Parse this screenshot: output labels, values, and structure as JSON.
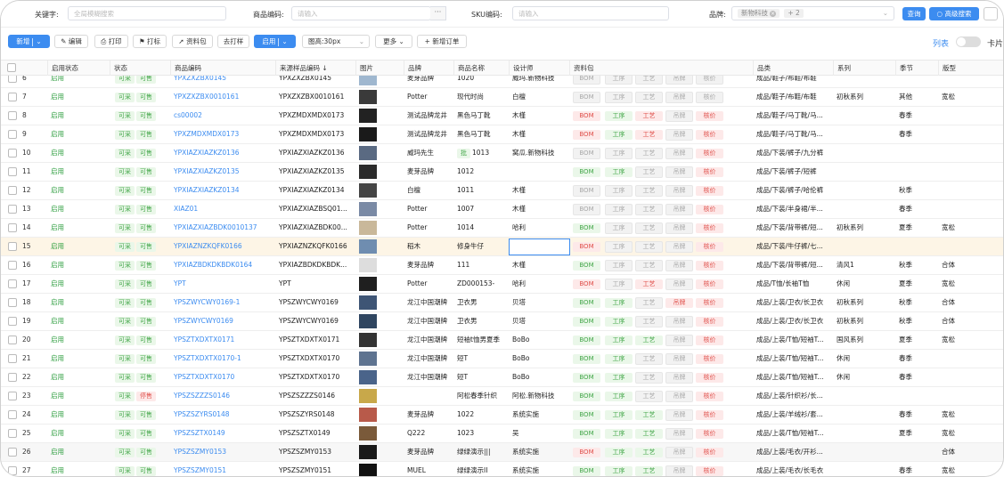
{
  "search": {
    "keyword_label": "关键字:",
    "keyword_placeholder": "全局模糊搜索",
    "code_label": "商品编码:",
    "code_placeholder": "请输入",
    "code_more": "···",
    "sku_label": "SKU编码:",
    "sku_placeholder": "请输入",
    "brand_label": "品牌:",
    "brand_tags": [
      "新物科技",
      "+ 2"
    ],
    "query_label": "查询",
    "advanced_label": "高级搜索"
  },
  "toolbar": {
    "add": "新增",
    "edit": "编辑",
    "print": "打印",
    "mark": "打标",
    "package": "资料包",
    "sample": "去打样",
    "enable": "启用",
    "img_height": "图高:30px",
    "more": "更多",
    "new_order": "新增订单",
    "view_list": "列表",
    "view_card": "卡片"
  },
  "columns": [
    "启用状态",
    "状态",
    "商品编码",
    "来源样品编码 ↓",
    "图片",
    "品牌",
    "商品名称",
    "设计师",
    "资料包",
    "品类",
    "系列",
    "季节",
    "版型"
  ],
  "pkg_labels": [
    "BOM",
    "工序",
    "工艺",
    "吊牌",
    "核价"
  ],
  "colors": {
    "accent": "#3c8cf0",
    "green": "#2e9e3f",
    "red": "#e0524d",
    "selected_row": "#fdf5e6"
  },
  "rows": [
    {
      "no": "6",
      "enabled": "启用",
      "s1": "可采",
      "s2": "可售",
      "code": "YPXZXZBX0145",
      "src": "YPXZXZBX0145",
      "brand": "麦芽品牌",
      "name": "1020",
      "designer": "威玛.新物科技",
      "pkg": [
        "gray",
        "gray",
        "gray",
        "gray",
        "gray"
      ],
      "cat": "成品/鞋子/布鞋/布鞋",
      "series": "",
      "season": "",
      "fit": ""
    },
    {
      "no": "7",
      "enabled": "启用",
      "s1": "可采",
      "s2": "可售",
      "code": "YPXZXZBX0010161",
      "src": "YPXZXZBX0010161",
      "brand": "Potter",
      "name": "现代时尚",
      "designer": "白檀",
      "pkg": [
        "gray",
        "gray",
        "gray",
        "gray",
        "gray"
      ],
      "cat": "成品/鞋子/布鞋/布鞋",
      "series": "初秋系列",
      "season": "其他",
      "fit": "宽松"
    },
    {
      "no": "8",
      "enabled": "启用",
      "s1": "可采",
      "s2": "可售",
      "code": "cs00002",
      "src": "YPXZMDXMDX0173",
      "brand": "测试品牌龙井",
      "name": "黑色马丁靴",
      "designer": "木槿",
      "pkg": [
        "r",
        "g",
        "r",
        "gray",
        "r"
      ],
      "cat": "成品/鞋子/马丁靴/马...",
      "series": "",
      "season": "春季",
      "fit": ""
    },
    {
      "no": "9",
      "enabled": "启用",
      "s1": "可采",
      "s2": "可售",
      "code": "YPXZMDXMDX0173",
      "src": "YPXZMDXMDX0173",
      "brand": "测试品牌龙井",
      "name": "黑色马丁靴",
      "designer": "木槿",
      "pkg": [
        "r",
        "g",
        "r",
        "gray",
        "r"
      ],
      "cat": "成品/鞋子/马丁靴/马...",
      "series": "",
      "season": "春季",
      "fit": ""
    },
    {
      "no": "10",
      "enabled": "启用",
      "s1": "可采",
      "s2": "可售",
      "code": "YPXIAZXIAZKZ0136",
      "src": "YPXIAZXIAZKZ0136",
      "brand": "威玛先生",
      "name": "1013",
      "name_badge": "批",
      "designer": "窝瓜.新物科技",
      "pkg": [
        "gray",
        "gray",
        "gray",
        "gray",
        "r"
      ],
      "cat": "成品/下装/裤子/九分裤",
      "series": "",
      "season": "",
      "fit": ""
    },
    {
      "no": "11",
      "enabled": "启用",
      "s1": "可采",
      "s2": "可售",
      "code": "YPXIAZXIAZKZ0135",
      "src": "YPXIAZXIAZKZ0135",
      "brand": "麦芽品牌",
      "name": "1012",
      "designer": "",
      "pkg": [
        "g",
        "g",
        "gray",
        "gray",
        "r"
      ],
      "cat": "成品/下装/裤子/短裤",
      "series": "",
      "season": "",
      "fit": ""
    },
    {
      "no": "12",
      "enabled": "启用",
      "s1": "可采",
      "s2": "可售",
      "code": "YPXIAZXIAZKZ0134",
      "src": "YPXIAZXIAZKZ0134",
      "brand": "白檀",
      "name": "1011",
      "designer": "木槿",
      "pkg": [
        "gray",
        "gray",
        "gray",
        "gray",
        "r"
      ],
      "cat": "成品/下装/裤子/哈伦裤",
      "series": "",
      "season": "秋季",
      "fit": ""
    },
    {
      "no": "13",
      "enabled": "启用",
      "s1": "可采",
      "s2": "可售",
      "code": "XIAZ01",
      "src": "YPXIAZXIAZBSQ01...",
      "brand": "Potter",
      "name": "1007",
      "designer": "木槿",
      "pkg": [
        "gray",
        "gray",
        "gray",
        "gray",
        "r"
      ],
      "cat": "成品/下装/半身裙/半...",
      "series": "",
      "season": "春季",
      "fit": ""
    },
    {
      "no": "14",
      "enabled": "启用",
      "s1": "可采",
      "s2": "可售",
      "code": "YPXIAZXIAZBDK0010137",
      "src": "YPXIAZXIAZBDK00...",
      "brand": "Potter",
      "name": "1014",
      "designer": "哈利",
      "pkg": [
        "g",
        "gray",
        "gray",
        "gray",
        "r"
      ],
      "cat": "成品/下装/背带裤/短...",
      "series": "初秋系列",
      "season": "夏季",
      "fit": "宽松"
    },
    {
      "no": "15",
      "enabled": "启用",
      "s1": "可采",
      "s2": "可售",
      "code": "YPXIAZNZKQFK0166",
      "src": "YPXIAZNZKQFK0166",
      "brand": "稻木",
      "name": "修身牛仔",
      "designer": "",
      "pkg": [
        "r",
        "gray",
        "gray",
        "gray",
        "r"
      ],
      "cat": "成品/下装/牛仔裤/七...",
      "series": "",
      "season": "",
      "fit": "",
      "selected": true
    },
    {
      "no": "16",
      "enabled": "启用",
      "s1": "可采",
      "s2": "可售",
      "code": "YPXIAZBDKDKBDK0164",
      "src": "YPXIAZBDKDKBDK...",
      "brand": "麦芽品牌",
      "name": "111",
      "designer": "木槿",
      "pkg": [
        "g",
        "gray",
        "gray",
        "gray",
        "r"
      ],
      "cat": "成品/下装/背带裤/短...",
      "series": "清风1",
      "season": "秋季",
      "fit": "合体"
    },
    {
      "no": "17",
      "enabled": "启用",
      "s1": "可采",
      "s2": "可售",
      "code": "YPT",
      "src": "YPT",
      "brand": "Potter",
      "name": "ZD000153-",
      "designer": "哈利",
      "pkg": [
        "r",
        "gray",
        "r",
        "gray",
        "r"
      ],
      "cat": "成品/T恤/长袖T恤",
      "series": "休闲",
      "season": "夏季",
      "fit": "宽松"
    },
    {
      "no": "18",
      "enabled": "启用",
      "s1": "可采",
      "s2": "可售",
      "code": "YPSZWYCWY0169-1",
      "src": "YPSZWYCWY0169",
      "brand": "龙江中国潮牌",
      "name": "卫衣男",
      "designer": "贝塔",
      "pkg": [
        "g",
        "g",
        "gray",
        "r",
        "r"
      ],
      "cat": "成品/上装/卫衣/长卫衣",
      "series": "初秋系列",
      "season": "秋季",
      "fit": "合体"
    },
    {
      "no": "19",
      "enabled": "启用",
      "s1": "可采",
      "s2": "可售",
      "code": "YPSZWYCWY0169",
      "src": "YPSZWYCWY0169",
      "brand": "龙江中国潮牌",
      "name": "卫衣男",
      "designer": "贝塔",
      "pkg": [
        "g",
        "g",
        "gray",
        "gray",
        "r"
      ],
      "cat": "成品/上装/卫衣/长卫衣",
      "series": "初秋系列",
      "season": "秋季",
      "fit": "合体"
    },
    {
      "no": "20",
      "enabled": "启用",
      "s1": "可采",
      "s2": "可售",
      "code": "YPSZTXDXTX0171",
      "src": "YPSZTXDXTX0171",
      "brand": "龙江中国潮牌",
      "name": "短袖t恤男夏季",
      "designer": "BoBo",
      "pkg": [
        "g",
        "g",
        "g",
        "gray",
        "r"
      ],
      "cat": "成品/上装/T恤/短袖T...",
      "series": "国风系列",
      "season": "夏季",
      "fit": "宽松"
    },
    {
      "no": "21",
      "enabled": "启用",
      "s1": "可采",
      "s2": "可售",
      "code": "YPSZTXDXTX0170-1",
      "src": "YPSZTXDXTX0170",
      "brand": "龙江中国潮牌",
      "name": "短T",
      "designer": "BoBo",
      "pkg": [
        "g",
        "g",
        "gray",
        "gray",
        "r"
      ],
      "cat": "成品/上装/T恤/短袖T...",
      "series": "休闲",
      "season": "春季",
      "fit": ""
    },
    {
      "no": "22",
      "enabled": "启用",
      "s1": "可采",
      "s2": "可售",
      "code": "YPSZTXDXTX0170",
      "src": "YPSZTXDXTX0170",
      "brand": "龙江中国潮牌",
      "name": "短T",
      "designer": "BoBo",
      "pkg": [
        "g",
        "g",
        "gray",
        "gray",
        "r"
      ],
      "cat": "成品/上装/T恤/短袖T...",
      "series": "休闲",
      "season": "春季",
      "fit": ""
    },
    {
      "no": "23",
      "enabled": "启用",
      "s1": "可采",
      "s2": "停售",
      "code": "YPSZSZZZS0146",
      "src": "YPSZSZZZS0146",
      "brand": "",
      "name": "阿松春季针织",
      "designer": "阿松.新物科技",
      "pkg": [
        "g",
        "g",
        "gray",
        "gray",
        "r"
      ],
      "cat": "成品/上装/针织衫/长...",
      "series": "",
      "season": "",
      "fit": ""
    },
    {
      "no": "24",
      "enabled": "启用",
      "s1": "可采",
      "s2": "可售",
      "code": "YPSZSZYRS0148",
      "src": "YPSZSZYRS0148",
      "brand": "麦芽品牌",
      "name": "1022",
      "designer": "系统实施",
      "pkg": [
        "g",
        "g",
        "g",
        "gray",
        "r"
      ],
      "cat": "成品/上装/羊绒衫/套...",
      "series": "",
      "season": "春季",
      "fit": "宽松"
    },
    {
      "no": "25",
      "enabled": "启用",
      "s1": "可采",
      "s2": "可售",
      "code": "YPSZSZTX0149",
      "src": "YPSZSZTX0149",
      "brand": "Q222",
      "name": "1023",
      "designer": "吴",
      "pkg": [
        "g",
        "g",
        "g",
        "gray",
        "r"
      ],
      "cat": "成品/上装/T恤/短袖T...",
      "series": "",
      "season": "夏季",
      "fit": "宽松"
    },
    {
      "no": "26",
      "enabled": "启用",
      "s1": "可采",
      "s2": "可售",
      "code": "YPSZSZMY0153",
      "src": "YPSZSZMY0153",
      "brand": "麦芽品牌",
      "name": "绿绿演示|||",
      "designer": "系统实施",
      "pkg": [
        "r",
        "g",
        "g",
        "gray",
        "r"
      ],
      "cat": "成品/上装/毛衣/开衫...",
      "series": "",
      "season": "",
      "fit": "合体",
      "alt": true
    },
    {
      "no": "27",
      "enabled": "启用",
      "s1": "可采",
      "s2": "可售",
      "code": "YPSZSZMY0151",
      "src": "YPSZSZMY0151",
      "brand": "MUEL",
      "name": "绿绿演示II",
      "designer": "系统实施",
      "pkg": [
        "g",
        "g",
        "g",
        "gray",
        "r"
      ],
      "cat": "成品/上装/毛衣/长毛衣",
      "series": "",
      "season": "春季",
      "fit": "宽松"
    }
  ]
}
